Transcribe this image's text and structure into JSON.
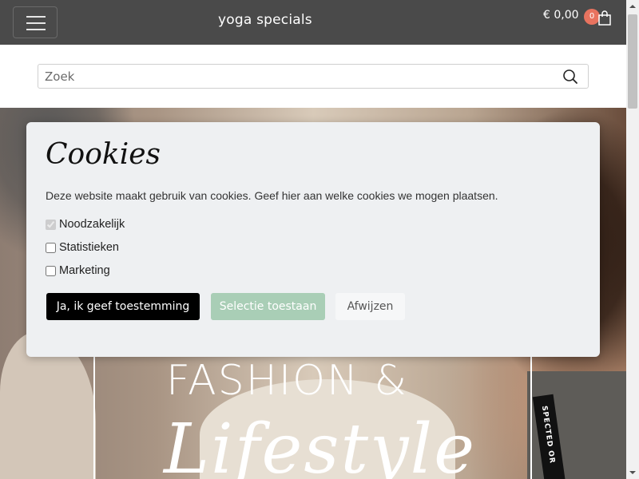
{
  "header": {
    "brand": "yoga specials",
    "cart_total": "€ 0,00",
    "cart_count": "0",
    "colors": {
      "bar": "#4a4a4a",
      "badge": "#e8735f"
    },
    "icons": [
      "menu-icon",
      "shopping-bag-icon"
    ]
  },
  "search": {
    "placeholder": "Zoek",
    "value": "",
    "icon": "search-icon"
  },
  "hero": {
    "title": "FASHION &",
    "script": "Lifestyle",
    "strap_text": "SPECTED OR"
  },
  "cookie_modal": {
    "title": "Cookies",
    "description": "Deze website maakt gebruik van cookies. Geef hier aan welke cookies we mogen plaatsen.",
    "options": [
      {
        "label": "Noodzakelijk",
        "checked": true,
        "disabled": true
      },
      {
        "label": "Statistieken",
        "checked": false,
        "disabled": false
      },
      {
        "label": "Marketing",
        "checked": false,
        "disabled": false
      }
    ],
    "buttons": {
      "accept": "Ja, ik geef toestemming",
      "select": "Selectie toestaan",
      "reject": "Afwijzen"
    },
    "colors": {
      "accept": "#000000",
      "select": "#a9ceb6",
      "reject": "#f6f7f8"
    }
  }
}
